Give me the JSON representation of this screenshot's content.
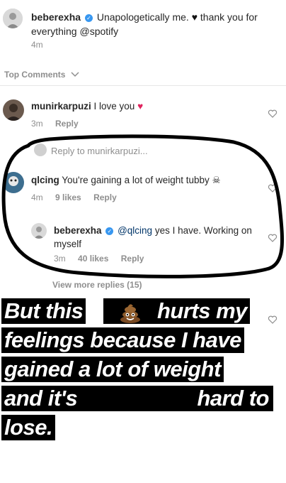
{
  "post": {
    "username": "beberexha",
    "caption": "Unapologetically me.",
    "caption_tail": "thank you for everything",
    "mention": "@spotify",
    "time": "4m"
  },
  "top_comments_label": "Top Comments",
  "comments": [
    {
      "username": "munirkarpuzi",
      "text": "I love you",
      "time": "3m",
      "reply": "Reply"
    }
  ],
  "reply_prompt": "Reply to munirkarpuzi...",
  "thread": {
    "username": "qlcing",
    "text": "You're gaining a lot of weight tubby",
    "time": "4m",
    "likes": "9 likes",
    "reply": "Reply"
  },
  "nested_reply": {
    "username": "beberexha",
    "mention": "@qlcing",
    "text": "yes I have. Working on myself",
    "time": "3m",
    "likes": "40 likes",
    "reply": "Reply"
  },
  "view_more": "View more replies (15)",
  "overlay": {
    "line1_a": "But this",
    "line1_b": "hurts my",
    "line2": "feelings because I have",
    "line3": "gained a lot of weight",
    "line4_a": "and it's",
    "line4_b": "hard to",
    "line5": "lose."
  },
  "icons": {
    "verified": "verified-badge-icon",
    "heart": "heart-outline-icon",
    "chevron": "chevron-down-icon",
    "poop": "poop-emoji-icon",
    "skull": "skull-emoji-icon",
    "red_heart": "red-heart-emoji-icon",
    "black_heart": "black-heart-emoji-icon"
  },
  "colors": {
    "verified": "#3897f0",
    "annotation_stroke": "#000000",
    "overlay_bg": "#000000",
    "overlay_text": "#ffffff"
  }
}
